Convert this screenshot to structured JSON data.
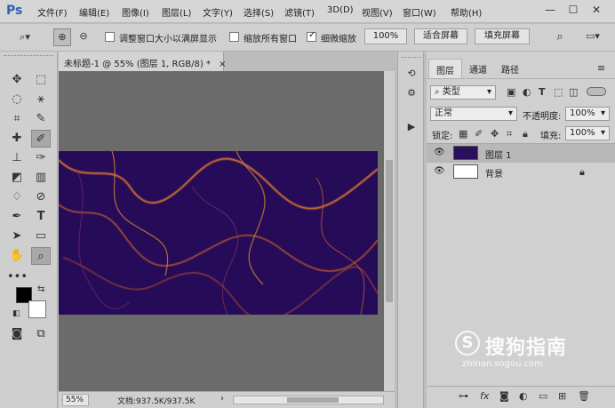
{
  "app": {
    "logo": "Ps"
  },
  "menu": [
    "文件(F)",
    "编辑(E)",
    "图像(I)",
    "图层(L)",
    "文字(Y)",
    "选择(S)",
    "滤镜(T)",
    "3D(D)",
    "视图(V)",
    "窗口(W)",
    "帮助(H)"
  ],
  "window_controls": {
    "minimize": "—",
    "maximize": "☐",
    "close": "✕"
  },
  "options": {
    "resize_windows_label": "调整窗口大小以满屏显示",
    "resize_windows_checked": false,
    "zoom_all_label": "缩放所有窗口",
    "zoom_all_checked": false,
    "scrubby_label": "细微缩放",
    "scrubby_checked": true,
    "btn_100": "100%",
    "btn_fit": "适合屏幕",
    "btn_fill": "填充屏幕"
  },
  "document": {
    "tab_title": "未标题-1 @ 55% (图层 1, RGB/8) *",
    "tab_close": "×",
    "zoom": "55%",
    "doc_info": "文档:937.5K/937.5K",
    "status_arrow": "›"
  },
  "layers_panel": {
    "tabs": [
      "图层",
      "通道",
      "路径"
    ],
    "active_tab": 0,
    "filter_kind": "类型",
    "blend_mode": "正常",
    "opacity_label": "不透明度:",
    "opacity_value": "100%",
    "lock_label": "锁定:",
    "fill_label": "填充:",
    "fill_value": "100%",
    "layers": [
      {
        "name": "图层 1",
        "selected": true,
        "thumb": "#2a0f5c",
        "locked": false
      },
      {
        "name": "背景",
        "selected": false,
        "thumb": "#ffffff",
        "locked": true
      }
    ]
  },
  "colors": {
    "foreground": "#000000",
    "background": "#ffffff",
    "canvas_base": "#260c58",
    "canvas_vein": "#e07a2a"
  },
  "watermark": {
    "main": "搜狗指南",
    "url": "zhinan.sogou.com",
    "logo_letter": "S"
  }
}
